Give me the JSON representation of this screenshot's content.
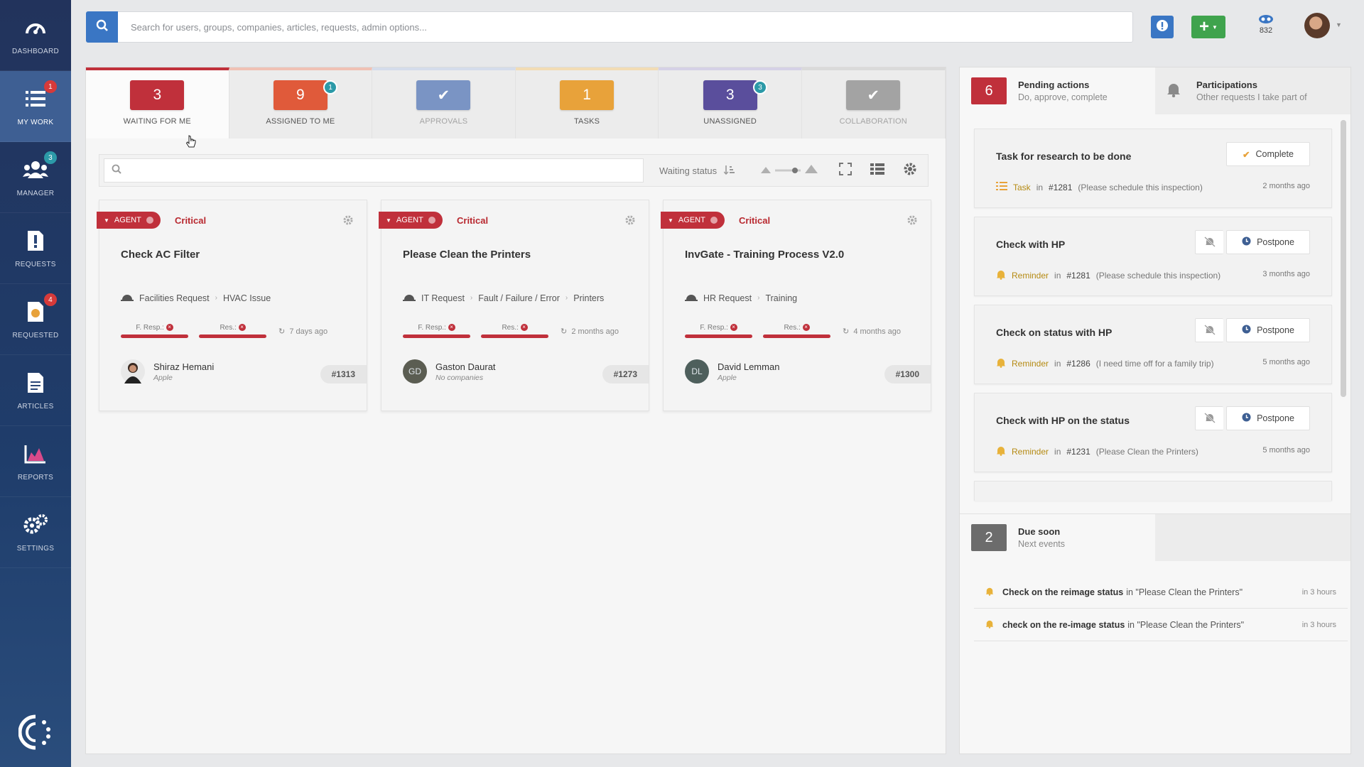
{
  "sidebar": {
    "items": [
      {
        "label": "DASHBOARD",
        "icon": "dashboard-gauge-icon",
        "badge": ""
      },
      {
        "label": "MY WORK",
        "icon": "list-icon",
        "badge": "1"
      },
      {
        "label": "MANAGER",
        "icon": "people-icon",
        "badge": "3"
      },
      {
        "label": "REQUESTS",
        "icon": "requests-icon",
        "badge": ""
      },
      {
        "label": "REQUESTED",
        "icon": "requested-icon",
        "badge": "4"
      },
      {
        "label": "ARTICLES",
        "icon": "document-icon",
        "badge": ""
      },
      {
        "label": "REPORTS",
        "icon": "chart-icon",
        "badge": ""
      },
      {
        "label": "SETTINGS",
        "icon": "gears-icon",
        "badge": ""
      }
    ]
  },
  "topbar": {
    "search_placeholder": "Search for users, groups, companies, articles, requests, admin options...",
    "counter": "832"
  },
  "tabs": [
    {
      "count": "3",
      "label": "WAITING FOR ME",
      "color": "#c0303b",
      "badge": ""
    },
    {
      "count": "9",
      "label": "ASSIGNED TO ME",
      "color": "#e05a3a",
      "badge": "1"
    },
    {
      "count": "✔",
      "label": "APPROVALS",
      "color": "#6f8fc4",
      "badge": ""
    },
    {
      "count": "1",
      "label": "TASKS",
      "color": "#e8a23a",
      "badge": ""
    },
    {
      "count": "3",
      "label": "UNASSIGNED",
      "color": "#5a4e9c",
      "badge": "3"
    },
    {
      "count": "✔",
      "label": "COLLABORATION",
      "color": "#9b9b9b",
      "badge": ""
    }
  ],
  "filter": {
    "search_value": "",
    "waiting_status": "Waiting status"
  },
  "cards": [
    {
      "agent": "AGENT",
      "priority": "Critical",
      "title": "Check AC Filter",
      "cat": "Facilities Request",
      "subcat": "HVAC Issue",
      "subsubcat": "",
      "f_resp": "F. Resp.:",
      "res": "Res.:",
      "ago": "7 days ago",
      "person": "Shiraz Hemani",
      "company": "Apple",
      "initials": "",
      "ticket": "#1313"
    },
    {
      "agent": "AGENT",
      "priority": "Critical",
      "title": "Please Clean the Printers",
      "cat": "IT Request",
      "subcat": "Fault / Failure / Error",
      "subsubcat": "Printers",
      "f_resp": "F. Resp.:",
      "res": "Res.:",
      "ago": "2 months ago",
      "person": "Gaston Daurat",
      "company": "No companies",
      "initials": "GD",
      "ticket": "#1273"
    },
    {
      "agent": "AGENT",
      "priority": "Critical",
      "title": "InvGate - Training Process V2.0",
      "cat": "HR Request",
      "subcat": "Training",
      "subsubcat": "",
      "f_resp": "F. Resp.:",
      "res": "Res.:",
      "ago": "4 months ago",
      "person": "David Lemman",
      "company": "Apple",
      "initials": "DL",
      "ticket": "#1300"
    }
  ],
  "right": {
    "pending": {
      "count": "6",
      "title": "Pending actions",
      "subtitle": "Do, approve, complete"
    },
    "participations": {
      "title": "Participations",
      "subtitle": "Other requests I take part of"
    },
    "actions": [
      {
        "title": "Task for research to be done",
        "button": "Complete",
        "kind": "Task",
        "in": "in",
        "request": "#1281",
        "note": "(Please schedule this inspection)",
        "when": "2 months ago"
      },
      {
        "title": "Check with HP",
        "button": "Postpone",
        "kind": "Reminder",
        "in": "in",
        "request": "#1281",
        "note": "(Please schedule this inspection)",
        "when": "3 months ago"
      },
      {
        "title": "Check on status with HP",
        "button": "Postpone",
        "kind": "Reminder",
        "in": "in",
        "request": "#1286",
        "note": "(I need time off for a family trip)",
        "when": "5 months ago"
      },
      {
        "title": "Check with HP on the status",
        "button": "Postpone",
        "kind": "Reminder",
        "in": "in",
        "request": "#1231",
        "note": "(Please Clean the Printers)",
        "when": "5 months ago"
      }
    ],
    "due": {
      "count": "2",
      "title": "Due soon",
      "subtitle": "Next events"
    },
    "due_items": [
      {
        "title": "Check on the reimage status",
        "in": "in \"Please Clean the Printers\"",
        "time": "in 3 hours"
      },
      {
        "title": "check on the re-image status",
        "in": "in \"Please Clean the Printers\"",
        "time": "in 3 hours"
      }
    ]
  }
}
